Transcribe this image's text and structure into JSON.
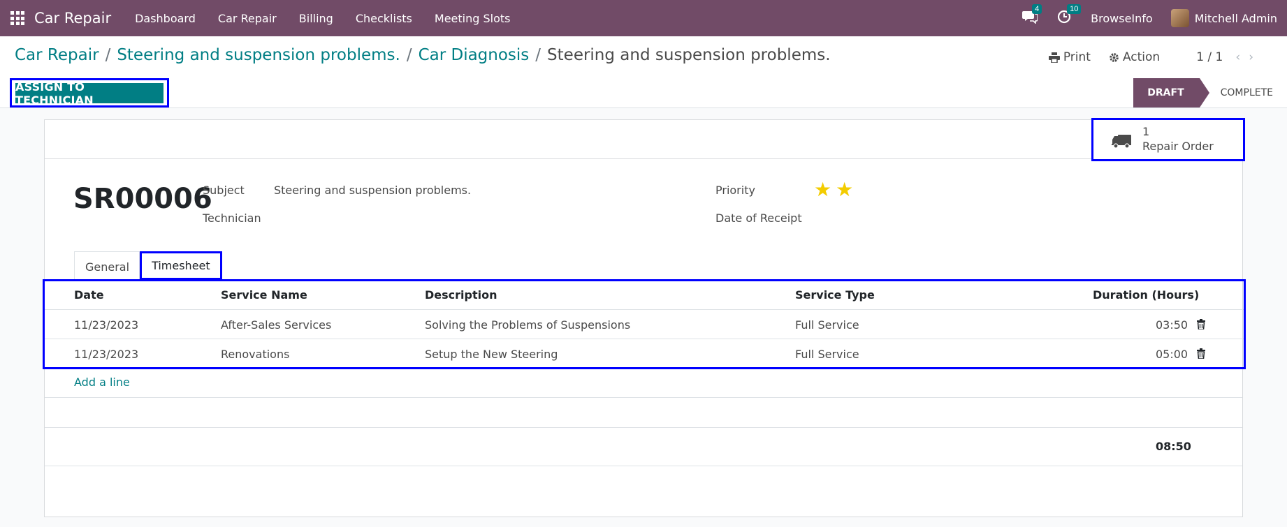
{
  "navbar": {
    "app_title": "Car Repair",
    "menu": [
      "Dashboard",
      "Car Repair",
      "Billing",
      "Checklists",
      "Meeting Slots"
    ],
    "messages_count": "4",
    "activities_count": "10",
    "company": "BrowseInfo",
    "user": "Mitchell Admin"
  },
  "breadcrumb": {
    "items": [
      "Car Repair",
      "Steering and suspension problems.",
      "Car Diagnosis"
    ],
    "current": "Steering and suspension problems."
  },
  "control": {
    "print_label": "Print",
    "action_label": "Action",
    "pager": "1 / 1",
    "assign_label": "ASSIGN TO TECHNICIAN",
    "stages": [
      "DRAFT",
      "COMPLETE"
    ],
    "active_stage": "DRAFT"
  },
  "form": {
    "smart_button": {
      "value": "1",
      "label": "Repair Order"
    },
    "reference": "SR00006",
    "subject_label": "Subject",
    "subject_value": "Steering and suspension problems.",
    "technician_label": "Technician",
    "priority_label": "Priority",
    "priority_stars": 2,
    "receipt_label": "Date of Receipt",
    "tabs": [
      "General",
      "Timesheet"
    ],
    "active_tab": "Timesheet"
  },
  "timesheet": {
    "columns": [
      "Date",
      "Service Name",
      "Description",
      "Service Type",
      "Duration (Hours)"
    ],
    "rows": [
      [
        "11/23/2023",
        "After-Sales Services",
        "Solving the Problems of Suspensions",
        "Full Service",
        "03:50"
      ],
      [
        "11/23/2023",
        "Renovations",
        "Setup the New Steering",
        "Full Service",
        "05:00"
      ]
    ],
    "add_line": "Add a line",
    "total": "08:50"
  },
  "colors": {
    "brand": "#714b67",
    "primary": "#017e84",
    "highlight": "#0000ff",
    "star": "#f3cc00"
  }
}
